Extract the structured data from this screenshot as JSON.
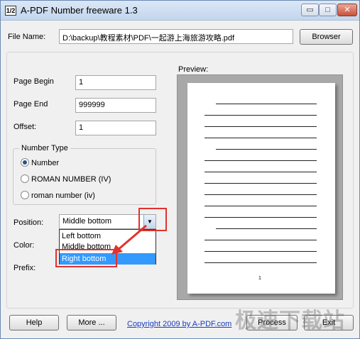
{
  "window": {
    "icon_text": "1/2",
    "title": "A-PDF Number freeware 1.3",
    "minimize": "▭",
    "maximize": "□",
    "close": "✕"
  },
  "file": {
    "label": "File Name:",
    "value": "D:\\backup\\教程素材\\PDF\\一起游上海旅游攻略.pdf",
    "browse_label": "Browser"
  },
  "fields": {
    "page_begin": {
      "label": "Page Begin",
      "value": "1"
    },
    "page_end": {
      "label": "Page End",
      "value": "999999"
    },
    "offset": {
      "label": "Offset:",
      "value": "1"
    }
  },
  "number_type": {
    "title": "Number Type",
    "options": [
      {
        "label": "Number",
        "checked": true
      },
      {
        "label": "ROMAN NUMBER (IV)",
        "checked": false
      },
      {
        "label": "roman number (iv)",
        "checked": false
      }
    ]
  },
  "position": {
    "label": "Position:",
    "selected": "Middle bottom",
    "options": [
      "Left bottom",
      "Middle bottom",
      "Right bottom"
    ],
    "highlighted": "Right bottom"
  },
  "color": {
    "label": "Color:"
  },
  "prefix": {
    "label": "Prefix:"
  },
  "preview": {
    "label": "Preview:",
    "page_number": "1"
  },
  "footer": {
    "help_label": "Help",
    "more_label": "More ...",
    "copyright_link": "Copyright 2009 by A-PDF.com",
    "process_label": "Process",
    "exit_label": "Exit"
  },
  "watermark": "极速下载站"
}
